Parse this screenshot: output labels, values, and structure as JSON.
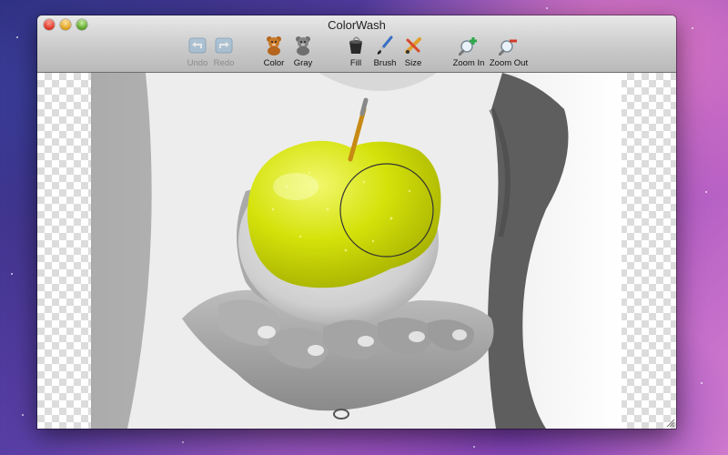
{
  "window": {
    "title": "ColorWash"
  },
  "toolbar": {
    "undo": {
      "label": "Undo",
      "icon": "undo-icon",
      "enabled": false
    },
    "redo": {
      "label": "Redo",
      "icon": "redo-icon",
      "enabled": false
    },
    "color": {
      "label": "Color",
      "icon": "teddy-bear-color-icon"
    },
    "gray": {
      "label": "Gray",
      "icon": "teddy-bear-gray-icon"
    },
    "fill": {
      "label": "Fill",
      "icon": "paint-bucket-icon"
    },
    "brush": {
      "label": "Brush",
      "icon": "brush-icon"
    },
    "size": {
      "label": "Size",
      "icon": "size-icon"
    },
    "zoom_in": {
      "label": "Zoom In",
      "icon": "zoom-in-icon"
    },
    "zoom_out": {
      "label": "Zoom Out",
      "icon": "zoom-out-icon"
    }
  },
  "colors": {
    "apple": "#d4e20a",
    "close": "#d52c1c",
    "minimize": "#dc9a12",
    "zoom": "#4e9a1b"
  }
}
